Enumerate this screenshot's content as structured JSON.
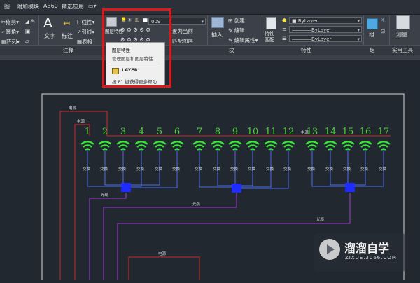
{
  "tabs": [
    "图",
    "附加模块",
    "A360",
    "精选应用"
  ],
  "home": {
    "modify": [
      "修剪",
      "圆角",
      "阵列"
    ],
    "annotation_tools": [
      "文字",
      "标注",
      "线性",
      "引线",
      "表格"
    ],
    "annotation_panel": "注释",
    "layers": {
      "layer_button": "图层特性",
      "layer_value": "009",
      "items": [
        "置为当前",
        "匹配图层"
      ]
    },
    "block": {
      "insert": "插入",
      "items": [
        "创建",
        "编辑",
        "编辑属性"
      ],
      "panel": "块"
    },
    "properties": {
      "match": "特性匹配",
      "color": "ByLayer",
      "linetype": "ByLayer",
      "lineweight": "ByLayer",
      "panel": "特性"
    },
    "group": {
      "label": "组",
      "panel": "组"
    },
    "utilities": {
      "label": "测量",
      "panel": "实用工具"
    }
  },
  "tooltip": {
    "title": "图层特性",
    "desc": "管理图层和图层特性",
    "command": "LAYER",
    "help": "按 F1 键获得更多帮助"
  },
  "drawing": {
    "numbers": [
      "1",
      "2",
      "3",
      "4",
      "5",
      "6",
      "7",
      "8",
      "9",
      "10",
      "11",
      "12",
      "13",
      "14",
      "15",
      "16",
      "17"
    ],
    "labels": {
      "power": "电源",
      "fiber": "交换",
      "optic": "光缆"
    }
  },
  "watermark": {
    "title": "溜溜自学",
    "url": "ZIXUE.3066.COM"
  },
  "colors": {
    "number_green": "#4cd137",
    "wifi_green": "#39e639",
    "hub_blue": "#1f2cff",
    "wire_blue": "#4a6df0",
    "wire_red": "#d02a2a",
    "wire_purple": "#a23ad6",
    "highlight": "#d81a1a"
  }
}
